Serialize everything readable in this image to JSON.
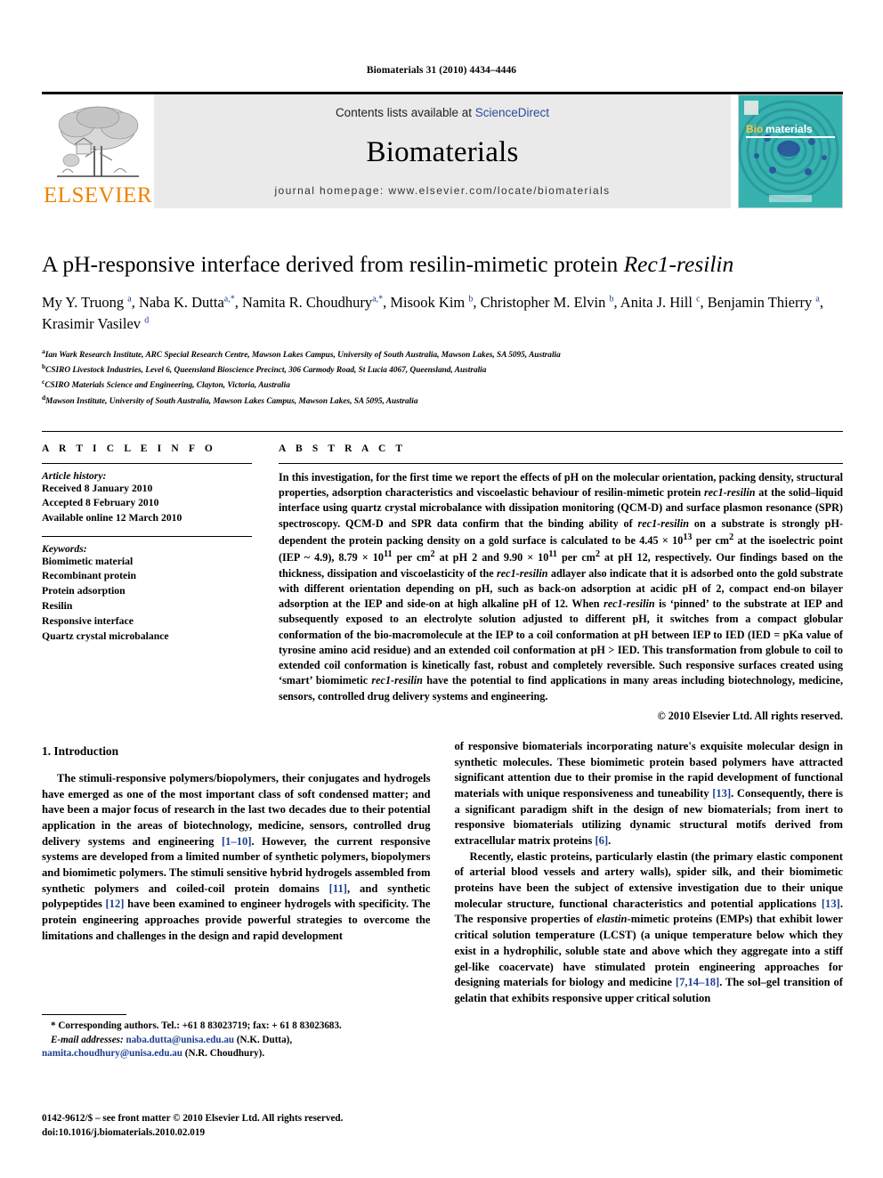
{
  "running_head": "Biomaterials 31 (2010) 4434–4446",
  "journal_header": {
    "contents_prefix": "Contents lists available at ",
    "sciencedirect": "ScienceDirect",
    "journal_name": "Biomaterials",
    "homepage": "journal homepage: www.elsevier.com/locate/biomaterials",
    "publisher_wordmark": "ELSEVIER",
    "publisher_color": "#ef8200",
    "cover_title_prefix": "Bio",
    "cover_title_suffix": "materials",
    "link_color": "#2b4a9b"
  },
  "article": {
    "title_plain": "A pH-responsive interface derived from resilin-mimetic protein ",
    "title_italic": "Rec1-resilin",
    "authors": "My Y. Truong a, Naba K. Dutta a,*, Namita R. Choudhury a,*, Misook Kim b, Christopher M. Elvin b, Anita J. Hill c, Benjamin Thierry a, Krasimir Vasilev d",
    "affiliations": [
      {
        "mark": "a",
        "text": "Ian Wark Research Institute, ARC Special Research Centre, Mawson Lakes Campus, University of South Australia, Mawson Lakes, SA 5095, Australia"
      },
      {
        "mark": "b",
        "text": "CSIRO Livestock Industries, Level 6, Queensland Bioscience Precinct, 306 Carmody Road, St Lucia 4067, Queensland, Australia"
      },
      {
        "mark": "c",
        "text": "CSIRO Materials Science and Engineering, Clayton, Victoria, Australia"
      },
      {
        "mark": "d",
        "text": "Mawson Institute, University of South Australia, Mawson Lakes Campus, Mawson Lakes, SA 5095, Australia"
      }
    ]
  },
  "article_info": {
    "label": "A R T I C L E  I N F O",
    "history_label": "Article history:",
    "history": [
      "Received 8 January 2010",
      "Accepted 8 February 2010",
      "Available online 12 March 2010"
    ],
    "keywords_label": "Keywords:",
    "keywords": [
      "Biomimetic material",
      "Recombinant protein",
      "Protein adsorption",
      "Resilin",
      "Responsive interface",
      "Quartz crystal microbalance"
    ]
  },
  "abstract": {
    "label": "A B S T R A C T",
    "copyright": "© 2010 Elsevier Ltd. All rights reserved."
  },
  "introduction": {
    "heading": "1.  Introduction",
    "left_paragraph_1_a": "The stimuli-responsive polymers/biopolymers, their conjugates and hydrogels have emerged as one of the most important class of soft condensed matter; and have been a major focus of research in the last two decades due to their potential application in the areas of biotechnology, medicine, sensors, controlled drug delivery systems and engineering ",
    "ref_1_10": "[1–10]",
    "left_paragraph_1_b": ". However, the current responsive systems are developed from a limited number of synthetic polymers, biopolymers and biomimetic polymers. The stimuli sensitive hybrid hydrogels assembled from synthetic polymers and coiled-coil protein domains ",
    "ref_11": "[11]",
    "left_paragraph_1_c": ", and synthetic polypeptides ",
    "ref_12": "[12]",
    "left_paragraph_1_d": " have been examined to engineer hydrogels with specificity. The protein engineering approaches provide powerful strategies to overcome the limitations and challenges in the design and rapid development",
    "right_paragraph_1_a": "of responsive biomaterials incorporating nature's exquisite molecular design in synthetic molecules. These biomimetic protein based polymers have attracted significant attention due to their promise in the rapid development of functional materials with unique responsiveness and tuneability ",
    "ref_13a": "[13]",
    "right_paragraph_1_b": ". Consequently, there is a significant paradigm shift in the design of new biomaterials; from inert to responsive biomaterials utilizing dynamic structural motifs derived from extracellular matrix proteins ",
    "ref_6": "[6]",
    "right_paragraph_1_c": ".",
    "right_paragraph_2_a": "Recently, elastic proteins, particularly elastin (the primary elastic component of arterial blood vessels and artery walls), spider silk, and their biomimetic proteins have been the subject of extensive investigation due to their unique molecular structure, functional characteristics and potential applications ",
    "ref_13b": "[13]",
    "right_paragraph_2_b": ". The responsive properties of ",
    "right_paragraph_2_italic": "elastin",
    "right_paragraph_2_c": "-mimetic proteins (EMPs) that exhibit lower critical solution temperature (LCST) (a unique temperature below which they exist in a hydrophilic, soluble state and above which they aggregate into a stiff gel-like coacervate) have stimulated protein engineering approaches for designing materials for biology and medicine ",
    "ref_7_14_18": "[7,14–18]",
    "right_paragraph_2_d": ". The sol–gel transition of gelatin that exhibits responsive upper critical solution"
  },
  "footnotes": {
    "corresponding": "* Corresponding authors. Tel.: +61 8 83023719; fax: + 61 8 83023683.",
    "email_label": "E-mail addresses:",
    "email_1": "naba.dutta@unisa.edu.au",
    "email_1_owner": " (N.K. Dutta), ",
    "email_2": "namita.choudhury@unisa.edu.au",
    "email_2_owner": " (N.R. Choudhury)."
  },
  "imprint": {
    "line_1": "0142-9612/$ – see front matter © 2010 Elsevier Ltd. All rights reserved.",
    "line_2": "doi:10.1016/j.biomaterials.2010.02.019"
  }
}
